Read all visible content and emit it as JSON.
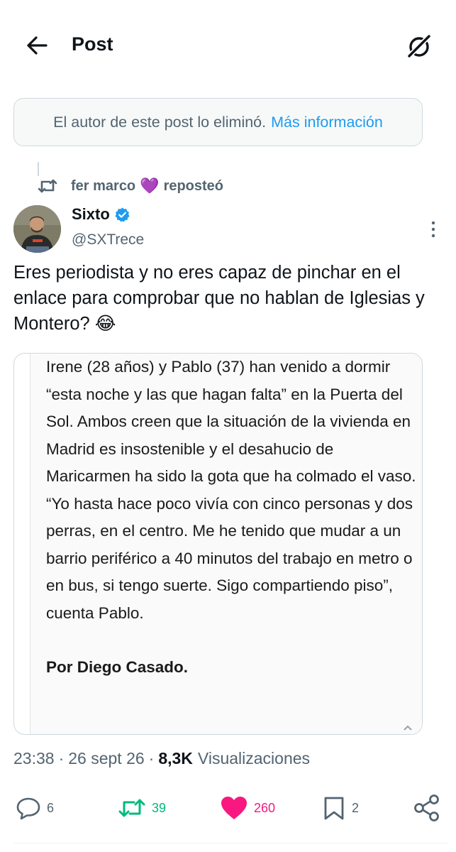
{
  "header": {
    "title": "Post",
    "back_icon": "arrow-left-icon",
    "grok_icon": "grok-icon"
  },
  "deleted_notice": {
    "text": "El autor de este post lo eliminó.",
    "link": "Más información"
  },
  "repost_context": {
    "user": "fer marco",
    "emoji": "💜",
    "action": "reposteó"
  },
  "post": {
    "author_name": "Sixto",
    "author_handle": "@SXTrece",
    "verified": true,
    "text": "Eres periodista y no eres capaz de pinchar en el enlace para comprobar que no hablan de Iglesias y Montero? 😂",
    "media": {
      "article_paragraph": "Irene (28 años) y Pablo (37) han venido a dormir “esta noche y las que hagan falta” en la Puerta del Sol. Ambos creen que la situación de la vivienda en Madrid es insostenible y el desahucio de Maricarmen ha sido la gota que ha colmado el vaso. “Yo hasta hace poco vivía con cinco personas y dos perras, en el centro. Me he tenido que mudar a un barrio periférico a 40 minutos del trabajo en metro o en bus, si tengo suerte. Sigo compartiendo piso”, cuenta Pablo.",
      "byline": "Por Diego Casado."
    },
    "time": "23:38",
    "date": "26 sept 26",
    "views_count": "8,3K",
    "views_label": "Visualizaciones"
  },
  "actions": {
    "replies": "6",
    "reposts": "39",
    "likes": "260",
    "bookmarks": "2"
  },
  "colors": {
    "accent": "#1d9bf0",
    "repost_green": "#00ba7c",
    "like_pink": "#f91880",
    "secondary_text": "#536471"
  }
}
